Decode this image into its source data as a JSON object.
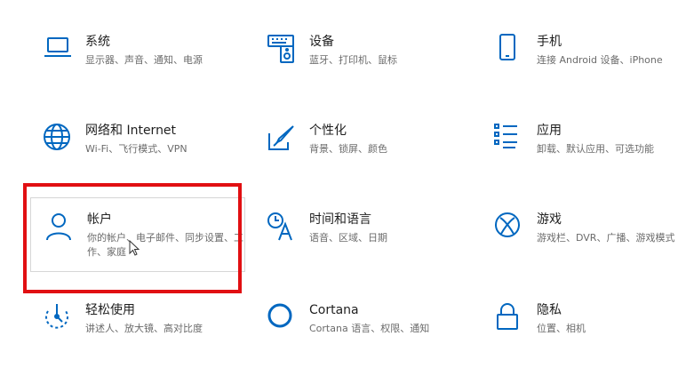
{
  "colors": {
    "accent": "#0067c0",
    "highlight": "#e10f12"
  },
  "tiles": [
    {
      "title": "系统",
      "desc": "显示器、声音、通知、电源",
      "icon": "laptop-icon"
    },
    {
      "title": "设备",
      "desc": "蓝牙、打印机、鼠标",
      "icon": "keyboard-speaker-icon"
    },
    {
      "title": "手机",
      "desc": "连接 Android 设备、iPhone",
      "icon": "phone-icon"
    },
    {
      "title": "网络和 Internet",
      "desc": "Wi-Fi、飞行模式、VPN",
      "icon": "globe-icon"
    },
    {
      "title": "个性化",
      "desc": "背景、锁屏、颜色",
      "icon": "paint-icon"
    },
    {
      "title": "应用",
      "desc": "卸载、默认应用、可选功能",
      "icon": "apps-list-icon"
    },
    {
      "title": "帐户",
      "desc": "你的帐户、电子邮件、同步设置、工作、家庭",
      "icon": "person-icon"
    },
    {
      "title": "时间和语言",
      "desc": "语音、区域、日期",
      "icon": "time-language-icon"
    },
    {
      "title": "游戏",
      "desc": "游戏栏、DVR、广播、游戏模式",
      "icon": "xbox-icon"
    },
    {
      "title": "轻松使用",
      "desc": "讲述人、放大镜、高对比度",
      "icon": "ease-of-access-icon"
    },
    {
      "title": "Cortana",
      "desc": "Cortana 语言、权限、通知",
      "icon": "cortana-icon"
    },
    {
      "title": "隐私",
      "desc": "位置、相机",
      "icon": "lock-icon"
    }
  ]
}
